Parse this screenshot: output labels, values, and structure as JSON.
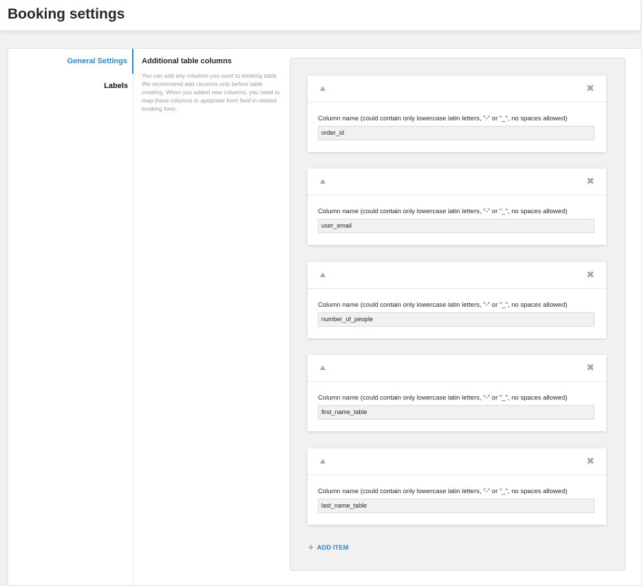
{
  "page": {
    "title": "Booking settings"
  },
  "nav": {
    "items": [
      {
        "label": "General Settings",
        "active": true
      },
      {
        "label": "Labels",
        "active": false
      }
    ]
  },
  "section": {
    "title": "Additional table columns",
    "description": "You can add any columns you want to booking table. We recommend add cloumns only before table creating. When you added new columns, you need to map these columns to apopriate form field in related booking form."
  },
  "repeater": {
    "field_label": "Column name (could contain only lowercase latin letters, \"-\" or \"_\", no spaces allowed)",
    "items": [
      {
        "value": "order_id"
      },
      {
        "value": "user_email"
      },
      {
        "value": "number_of_people"
      },
      {
        "value": "first_name_table"
      },
      {
        "value": "last_name_table"
      }
    ],
    "add_label": "ADD ITEM"
  },
  "icons": {
    "collapse": "triangle-up-icon",
    "remove": "close-icon",
    "add": "plus-icon"
  },
  "colors": {
    "accent": "#2a89d2"
  }
}
